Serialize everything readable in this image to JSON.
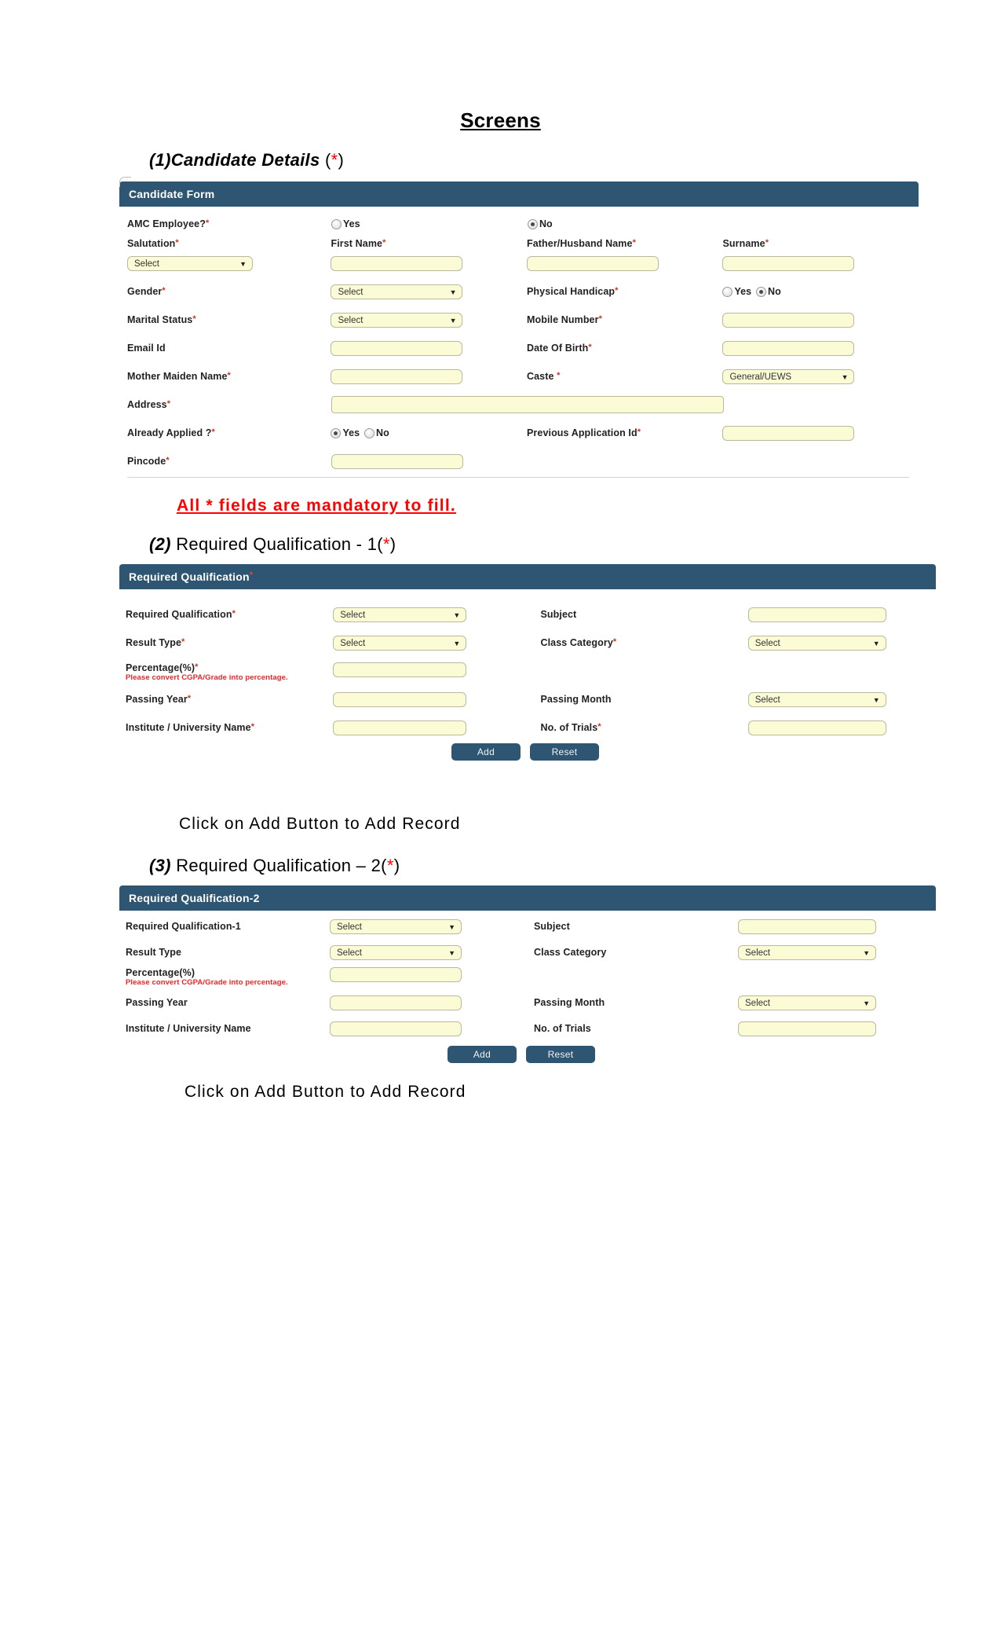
{
  "document": {
    "title": "Screens",
    "mandatory_note": "All * fields are mandatory to fill.",
    "click_note_1": "Click on Add Button to Add Record",
    "click_note_2": "Click on Add Button to Add Record"
  },
  "sections": [
    {
      "number": "(1)",
      "title_italic": "Candidate Details",
      "title_plain": "",
      "suffix_open": "(",
      "suffix_star": "*",
      "suffix_close": ")"
    },
    {
      "number": "(2)",
      "title_italic": "",
      "title_plain": "Required Qualification - 1",
      "suffix_open": "(",
      "suffix_star": "*",
      "suffix_close": ")"
    },
    {
      "number": "(3)",
      "title_italic": "",
      "title_plain": "Required Qualification – 2",
      "suffix_open": "(",
      "suffix_star": "*",
      "suffix_close": ")"
    }
  ],
  "candidate_form": {
    "header": "Candidate Form",
    "header_star": "",
    "fields": {
      "amc_employee_label": "AMC Employee?",
      "amc_employee_yes": "Yes",
      "amc_employee_no": "No",
      "salutation_label": "Salutation",
      "salutation_value": "Select",
      "first_name_label": "First Name",
      "first_name_value": "",
      "father_husband_label": "Father/Husband Name",
      "father_husband_value": "",
      "surname_label": "Surname",
      "surname_value": "",
      "gender_label": "Gender",
      "gender_value": "Select",
      "physical_handicap_label": "Physical Handicap",
      "physical_handicap_yes": "Yes",
      "physical_handicap_no": "No",
      "marital_status_label": "Marital Status",
      "marital_status_value": "Select",
      "mobile_number_label": "Mobile Number",
      "mobile_number_value": "",
      "email_label": "Email Id",
      "email_value": "",
      "dob_label": "Date Of Birth",
      "dob_value": "",
      "mother_maiden_label": "Mother Maiden Name",
      "mother_maiden_value": "",
      "caste_label": "Caste ",
      "caste_value": "General/UEWS",
      "address_label": "Address",
      "address_value": "",
      "already_applied_label": "Already Applied ?",
      "already_applied_yes": "Yes",
      "already_applied_no": "No",
      "previous_app_id_label": "Previous Application Id",
      "previous_app_id_value": "",
      "pincode_label": "Pincode",
      "pincode_value": ""
    }
  },
  "qualification_1": {
    "header": "Required Qualification",
    "header_star": "*",
    "fields": {
      "required_qualification_label": "Required Qualification",
      "required_qualification_value": "Select",
      "subject_label": "Subject",
      "subject_value": "",
      "result_type_label": "Result Type",
      "result_type_value": "Select",
      "class_category_label": "Class Category",
      "class_category_value": "Select",
      "percentage_label": "Percentage(%)",
      "percentage_note": "Please convert CGPA/Grade into percentage.",
      "percentage_value": "",
      "passing_year_label": "Passing Year",
      "passing_year_value": "",
      "passing_month_label": "Passing Month",
      "passing_month_value": "Select",
      "institute_label": "Institute / University Name",
      "institute_value": "",
      "trials_label": "No. of Trials",
      "trials_value": ""
    },
    "buttons": {
      "add": "Add",
      "reset": "Reset"
    }
  },
  "qualification_2": {
    "header": "Required Qualification-2",
    "header_star": "",
    "fields": {
      "required_qualification_label": "Required Qualification-1",
      "required_qualification_value": "Select",
      "subject_label": "Subject",
      "subject_value": "",
      "result_type_label": "Result Type",
      "result_type_value": "Select",
      "class_category_label": "Class Category",
      "class_category_value": "Select",
      "percentage_label": "Percentage(%)",
      "percentage_note": "Please convert CGPA/Grade into percentage.",
      "percentage_value": "",
      "passing_year_label": "Passing Year",
      "passing_year_value": "",
      "passing_month_label": "Passing Month",
      "passing_month_value": "Select",
      "institute_label": "Institute / University Name",
      "institute_value": "",
      "trials_label": "No. of Trials",
      "trials_value": ""
    },
    "buttons": {
      "add": "Add",
      "reset": "Reset"
    }
  },
  "icons": {
    "dropdown_arrow": "▼"
  },
  "colors": {
    "panel_header": "#2e5571",
    "field_background": "#fbfbd6",
    "required_star": "#c0392b",
    "note_red": "#e8262a"
  }
}
